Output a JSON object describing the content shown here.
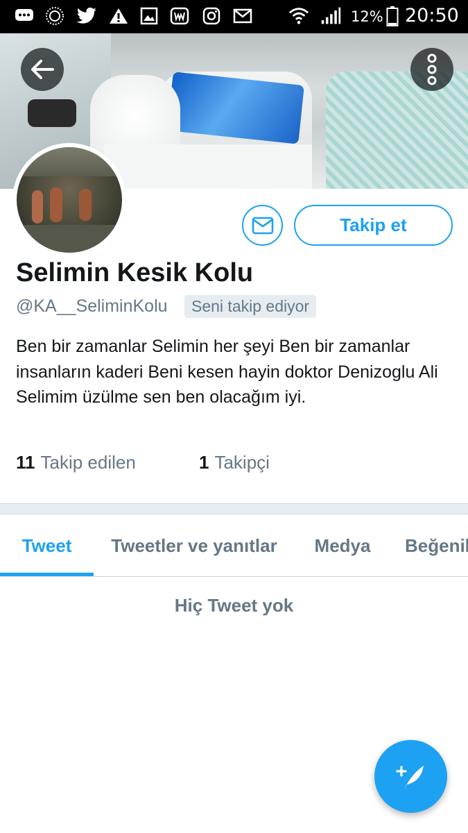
{
  "status_bar": {
    "battery_percent": "12%",
    "time": "20:50",
    "icons": [
      "messages-icon",
      "spinner-icon",
      "twitter-icon",
      "warning-icon",
      "gallery-icon",
      "app-w-icon",
      "instagram-icon",
      "gmail-icon",
      "wifi-icon",
      "signal-icon",
      "battery-icon"
    ]
  },
  "header": {
    "back_icon": "arrow-left-icon",
    "menu_icon": "more-vertical-icon"
  },
  "profile": {
    "name": "Selimin Kesik Kolu",
    "handle": "@KA__SeliminKolu",
    "follows_you_badge": "Seni takip ediyor",
    "bio": "Ben bir zamanlar Selimin her şeyi Ben bir zamanlar insanların kaderi Beni kesen hayin doktor Denizoglu Ali Selimim üzülme sen ben olacağım iyi.",
    "following_count": "11",
    "following_label": "Takip edilen",
    "followers_count": "1",
    "followers_label": "Takipçi"
  },
  "actions": {
    "message_icon": "envelope-icon",
    "follow_label": "Takip et"
  },
  "tabs": [
    {
      "label": "Tweet",
      "active": true
    },
    {
      "label": "Tweetler ve yanıtlar",
      "active": false
    },
    {
      "label": "Medya",
      "active": false
    },
    {
      "label": "Beğeniler",
      "active": false
    }
  ],
  "empty_state": "Hiç Tweet yok",
  "fab": {
    "icon": "compose-tweet-icon"
  },
  "colors": {
    "accent": "#1da1f2",
    "secondary_text": "#657786",
    "primary_text": "#14171a"
  }
}
